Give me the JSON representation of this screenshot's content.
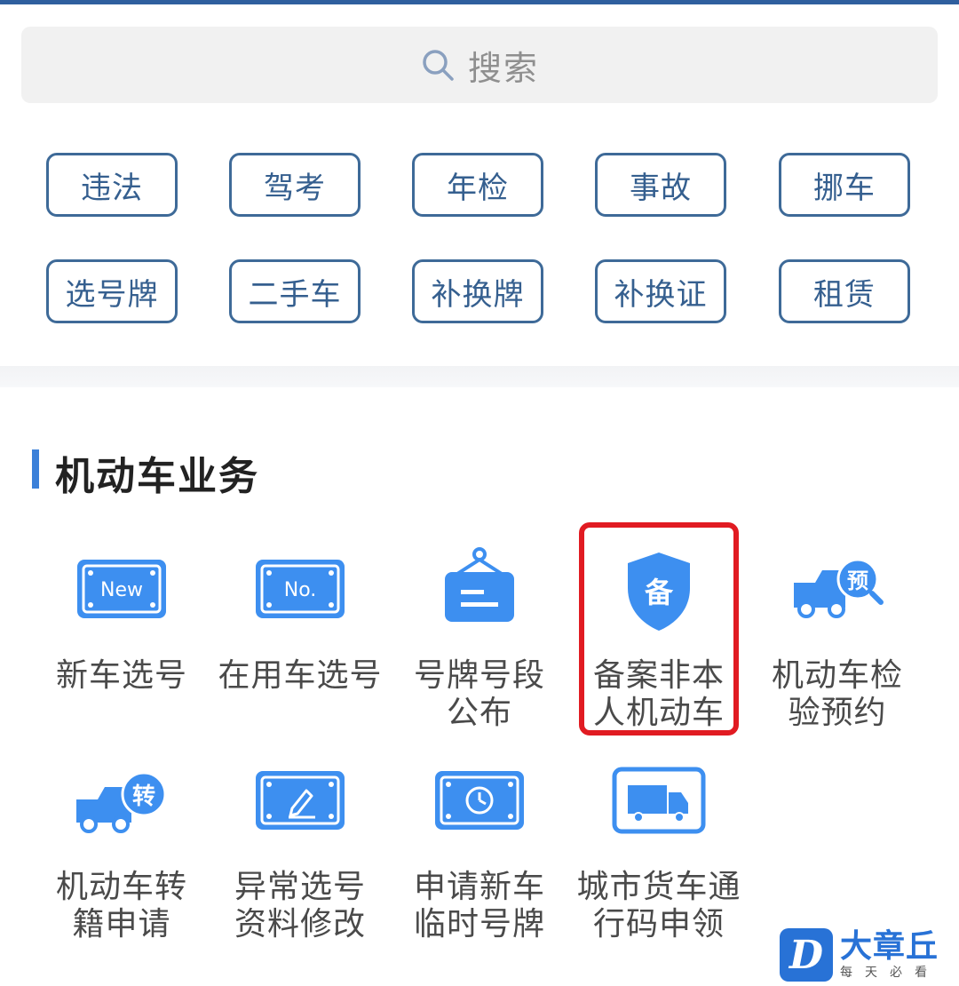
{
  "search": {
    "placeholder": "搜索"
  },
  "quick_tags": {
    "row1": [
      "违法",
      "驾考",
      "年检",
      "事故",
      "挪车"
    ],
    "row2": [
      "选号牌",
      "二手车",
      "补换牌",
      "补换证",
      "租赁"
    ]
  },
  "section": {
    "title": "机动车业务"
  },
  "services": [
    {
      "label": "新车选号",
      "icon": "new-plate-icon"
    },
    {
      "label": "在用车选号",
      "icon": "no-plate-icon"
    },
    {
      "label": "号牌号段公布",
      "icon": "hanging-sign-icon"
    },
    {
      "label": "备案非本人机动车",
      "icon": "shield-bei-icon"
    },
    {
      "label": "机动车检验预约",
      "icon": "truck-appointment-icon"
    },
    {
      "label": "机动车转籍申请",
      "icon": "truck-transfer-icon"
    },
    {
      "label": "异常选号资料修改",
      "icon": "plate-edit-icon"
    },
    {
      "label": "申请新车临时号牌",
      "icon": "plate-clock-icon"
    },
    {
      "label": "城市货车通行码申领",
      "icon": "cargo-truck-icon"
    }
  ],
  "service_lines": [
    [
      "新车选号"
    ],
    [
      "在用车选号"
    ],
    [
      "号牌号段",
      "公布"
    ],
    [
      "备案非本",
      "人机动车"
    ],
    [
      "机动车检",
      "验预约"
    ],
    [
      "机动车转",
      "籍申请"
    ],
    [
      "异常选号",
      "资料修改"
    ],
    [
      "申请新车",
      "临时号牌"
    ],
    [
      "城市货车通",
      "行码申领"
    ]
  ],
  "icon_text": {
    "new": "New",
    "no": "No.",
    "bei": "备",
    "yu": "预",
    "zhuan": "转"
  },
  "watermark": {
    "logo": "D",
    "name": "大章丘",
    "slogan": "每天必看"
  },
  "colors": {
    "accent": "#3b80d9",
    "chip_border": "#3e6a98",
    "highlight": "#e11b22"
  }
}
